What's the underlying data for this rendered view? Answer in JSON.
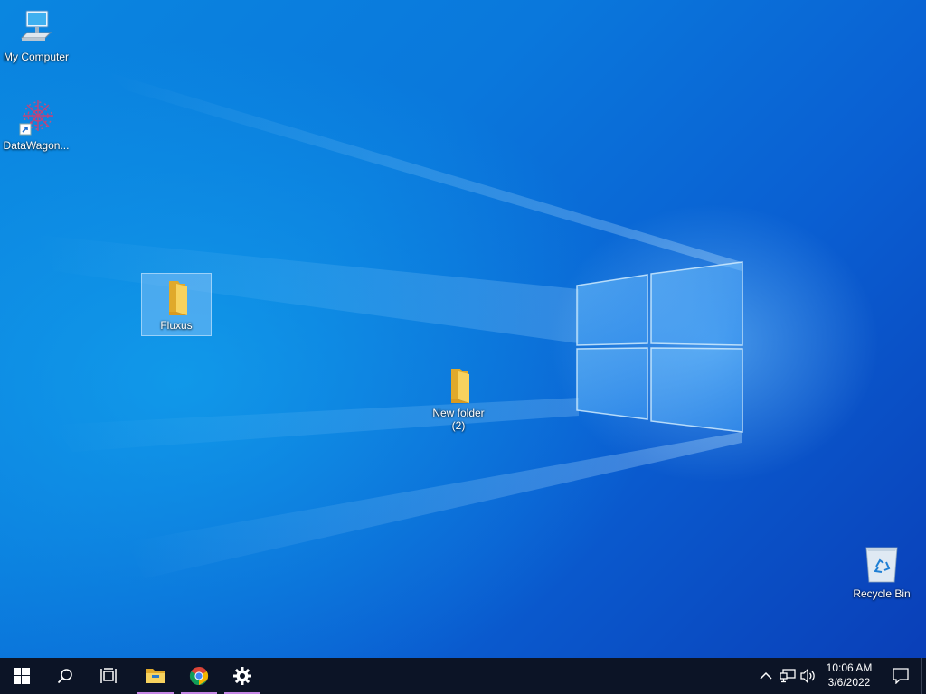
{
  "desktop": {
    "icons": [
      {
        "label": "My Computer",
        "icon": "computer-icon"
      },
      {
        "label": "DataWagon...",
        "icon": "datawagon-shortcut-icon"
      },
      {
        "label": "Fluxus",
        "icon": "folder-icon",
        "selected": true
      },
      {
        "label": "New folder\n(2)",
        "icon": "folder-icon"
      },
      {
        "label": "Recycle Bin",
        "icon": "recycle-bin-icon"
      }
    ]
  },
  "taskbar": {
    "buttons": [
      "start-icon",
      "search-icon",
      "task-view-icon",
      "file-explorer-icon",
      "chrome-icon",
      "settings-icon"
    ],
    "tray": {
      "time": "10:06 AM",
      "date": "3/6/2022",
      "icons": [
        "chevron-up-icon",
        "network-icon",
        "volume-icon",
        "notification-icon"
      ]
    }
  },
  "colors": {
    "taskbar": "#0c1426",
    "active_indicator": "#c586e6",
    "folder": "#f3c94d",
    "desktop_blue": "#0a6fd8"
  }
}
